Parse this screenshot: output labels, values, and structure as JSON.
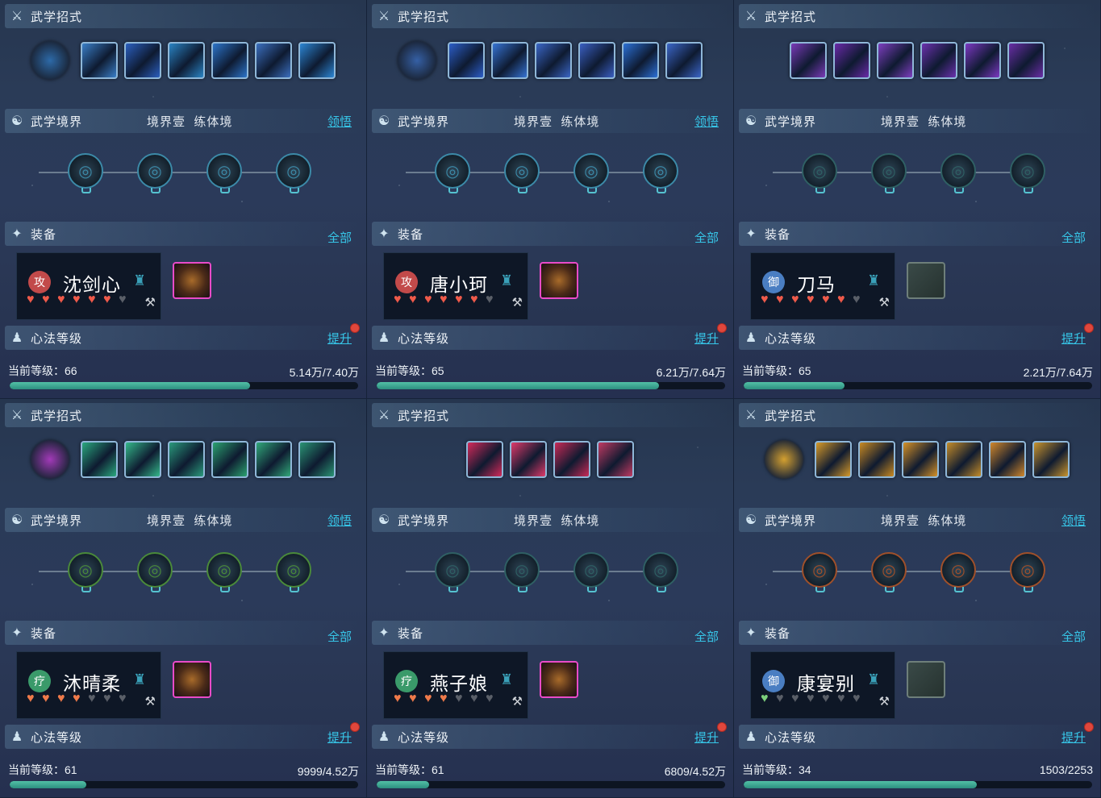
{
  "labels": {
    "moves": "武学招式",
    "realm": "武学境界",
    "realm_level": "境界壹",
    "realm_stage": "练体境",
    "realm_action": "领悟",
    "equip": "装备",
    "equip_all": "全部",
    "heart_method": "心法等级",
    "upgrade": "提升",
    "level_prefix": "当前等级："
  },
  "colors": {
    "accent_link": "#37c6e8",
    "bar_fill": "#3aa892",
    "heart_on": "#ef5a4a",
    "alert_dot": "#e0473c"
  },
  "panels": [
    {
      "char": "沈剑心",
      "role": "攻",
      "role_color": "#c24a4a",
      "level": "66",
      "exp": "5.14万/7.40万",
      "progress": 0.69,
      "hearts_on": 6,
      "hearts_total": 7,
      "heart_style": "red",
      "gear": "pink",
      "show_realm_action": true,
      "skills": [
        "#3a7ec7",
        "#2b5fbf",
        "#2a84c4",
        "#2c74c9",
        "#3b6fbf",
        "#2c86d4"
      ],
      "main_skill": "#2d6aa8",
      "nodes": [
        "#3c8aa8",
        "#3c8aa8",
        "#3c8aa8",
        "#3c8aa8"
      ]
    },
    {
      "char": "唐小珂",
      "role": "攻",
      "role_color": "#c24a4a",
      "level": "65",
      "exp": "6.21万/7.64万",
      "progress": 0.81,
      "hearts_on": 6,
      "hearts_total": 7,
      "heart_style": "red",
      "gear": "pink",
      "show_realm_action": true,
      "skills": [
        "#2c5ec8",
        "#3673d3",
        "#3a66c6",
        "#3a5fc2",
        "#2c70d6",
        "#3b66c8"
      ],
      "main_skill": "#3560a5",
      "nodes": [
        "#3c8aa8",
        "#3c8aa8",
        "#3c8aa8",
        "#3c8aa8"
      ]
    },
    {
      "char": "刀马",
      "role": "御",
      "role_color": "#4a7ec2",
      "level": "65",
      "exp": "2.21万/7.64万",
      "progress": 0.29,
      "hearts_on": 6,
      "hearts_total": 7,
      "heart_style": "red",
      "gear": "empty",
      "show_realm_action": false,
      "skills": [
        "#7a3ab8",
        "#6a2aa8",
        "#7e3fc0",
        "#6b31ae",
        "#7c38c2",
        "#6a2ea6"
      ],
      "main_skill": "",
      "nodes": [
        "#2f6064",
        "#2f6064",
        "#2f6064",
        "#2f6064"
      ]
    },
    {
      "char": "沐晴柔",
      "role": "疗",
      "role_color": "#3a9a6a",
      "level": "61",
      "exp": "9999/4.52万",
      "progress": 0.22,
      "hearts_on": 4,
      "hearts_total": 7,
      "heart_style": "orange",
      "gear": "pink",
      "show_realm_action": true,
      "skills": [
        "#2aa87e",
        "#34b88a",
        "#2a9a7c",
        "#2ba270",
        "#31a87a",
        "#2a9474"
      ],
      "main_skill": "#a23ab8",
      "nodes": [
        "#4a8a3a",
        "#4a8a3a",
        "#4a8a3a",
        "#4a8a3a"
      ]
    },
    {
      "char": "燕子娘",
      "role": "疗",
      "role_color": "#3a9a6a",
      "level": "61",
      "exp": "6809/4.52万",
      "progress": 0.15,
      "hearts_on": 4,
      "hearts_total": 7,
      "heart_style": "orange",
      "gear": "pink",
      "show_realm_action": false,
      "skills": [
        "#d42a5a",
        "#e03a6a",
        "#c92a56",
        "#c13a62"
      ],
      "main_skill": "",
      "nodes": [
        "#2f6064",
        "#2f6064",
        "#2f6064",
        "#2f6064"
      ]
    },
    {
      "char": "康宴别",
      "role": "御",
      "role_color": "#4a7ec2",
      "level": "34",
      "exp": "1503/2253",
      "progress": 0.67,
      "hearts_on": 1,
      "hearts_total": 7,
      "heart_style": "green",
      "gear": "empty",
      "show_realm_action": true,
      "skills": [
        "#d79a2a",
        "#c98a22",
        "#d69228",
        "#c58d2a",
        "#d2882c",
        "#c9942e"
      ],
      "main_skill": "#d4a030",
      "nodes": [
        "#a0502a",
        "#a0502a",
        "#a0502a",
        "#a0502a"
      ]
    }
  ]
}
